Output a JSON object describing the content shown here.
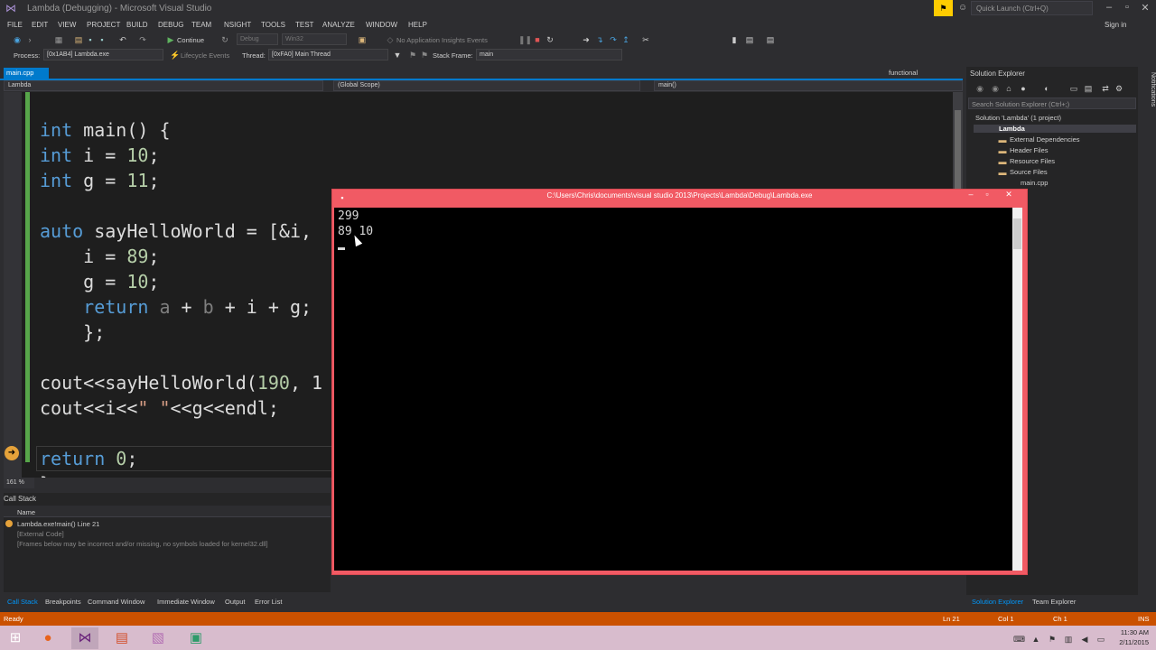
{
  "window": {
    "title": "Lambda (Debugging) - Microsoft Visual Studio",
    "quick_launch_placeholder": "Quick Launch (Ctrl+Q)",
    "sign_in": "Sign in"
  },
  "menu": [
    "FILE",
    "EDIT",
    "VIEW",
    "PROJECT",
    "BUILD",
    "DEBUG",
    "TEAM",
    "NSIGHT",
    "TOOLS",
    "TEST",
    "ANALYZE",
    "WINDOW",
    "HELP"
  ],
  "toolbar": {
    "continue_label": "Continue",
    "config": "Debug",
    "platform": "Win32",
    "insights": "No Application Insights Events",
    "process_label": "Process:",
    "process_value": "[0x1AB4] Lambda.exe",
    "lifecycle": "Lifecycle Events",
    "thread_label": "Thread:",
    "thread_value": "[0xFA0] Main Thread",
    "stack_frame_label": "Stack Frame:",
    "stack_frame_value": "main"
  },
  "editor": {
    "tab_active": "main.cpp",
    "tab_right": "functional",
    "nav_project": "Lambda",
    "nav_scope": "(Global Scope)",
    "nav_function": "main()",
    "zoom": "161 %",
    "code": {
      "l1_kw": "int",
      "l1_rest": " main() {",
      "l2_kw": "int",
      "l2_mid": " i = ",
      "l2_num": "10",
      "l2_end": ";",
      "l3_kw": "int",
      "l3_mid": " g = ",
      "l3_num": "11",
      "l3_end": ";",
      "l5_kw": "auto",
      "l5_rest": " sayHelloWorld = [&i,",
      "l6_pre": "    i = ",
      "l6_num": "89",
      "l6_end": ";",
      "l7_pre": "    g = ",
      "l7_num": "10",
      "l7_end": ";",
      "l8_kw": "    return",
      "l8_a": " a",
      "l8_plus1": " + ",
      "l8_b": "b",
      "l8_rest": " + i + g;",
      "l9": "    };",
      "l11_pre": "cout<<sayHelloWorld(",
      "l11_num": "190",
      "l11_rest": ", 1",
      "l12_pre": "cout<<i<<",
      "l12_str": "\" \"",
      "l12_rest": "<<g<<endl;",
      "l14_kw": "return",
      "l14_num": " 0",
      "l14_end": ";",
      "l15": "}"
    }
  },
  "call_stack": {
    "title": "Call Stack",
    "column": "Name",
    "rows": [
      "Lambda.exe!main() Line 21",
      "[External Code]",
      "[Frames below may be incorrect and/or missing, no symbols loaded for kernel32.dll]"
    ]
  },
  "bottom_tabs": [
    "Call Stack",
    "Breakpoints",
    "Command Window",
    "Immediate Window",
    "Output",
    "Error List"
  ],
  "solution_explorer": {
    "title": "Solution Explorer",
    "search_placeholder": "Search Solution Explorer (Ctrl+;)",
    "items": [
      "Solution 'Lambda' (1 project)",
      "Lambda",
      "External Dependencies",
      "Header Files",
      "Resource Files",
      "Source Files",
      "main.cpp"
    ],
    "tabs": [
      "Solution Explorer",
      "Team Explorer"
    ],
    "notifications": "Notifications"
  },
  "console": {
    "title": "C:\\Users\\Chris\\documents\\visual studio 2013\\Projects\\Lambda\\Debug\\Lambda.exe",
    "line1": "299",
    "line2": "89 10"
  },
  "status": {
    "state": "Ready",
    "ln": "Ln 21",
    "col": "Col 1",
    "ch": "Ch 1",
    "ins": "INS"
  },
  "clock": {
    "time": "11:30 AM",
    "date": "2/11/2015"
  },
  "colors": {
    "accent": "#007acc",
    "status_bar": "#ca5100",
    "console_frame": "#f15a64",
    "taskbar": "#d8bccd"
  }
}
